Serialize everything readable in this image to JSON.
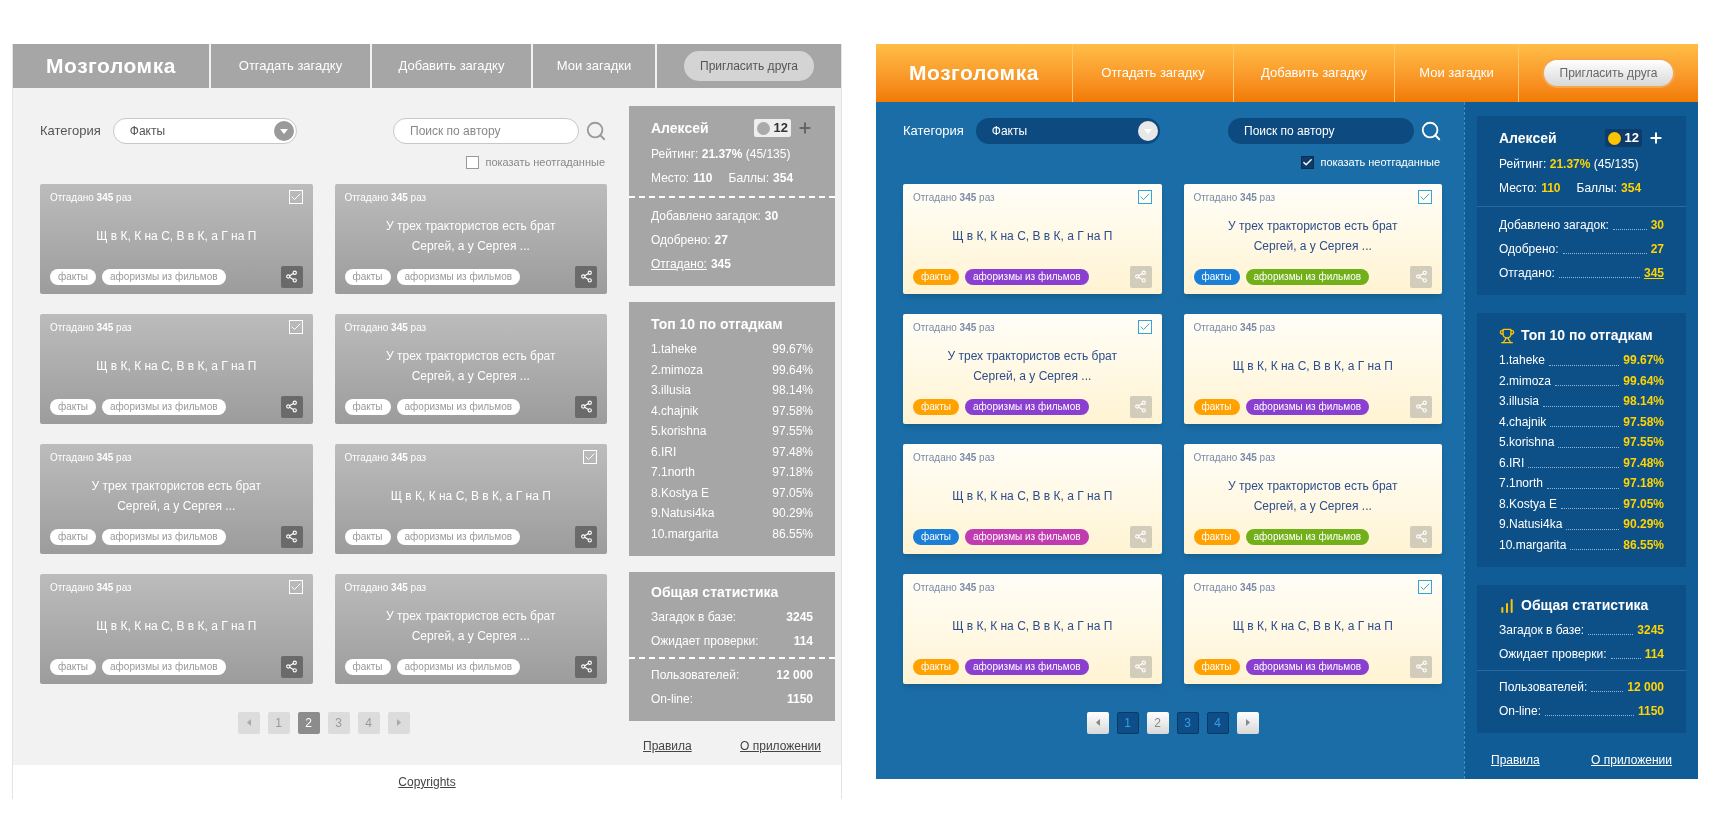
{
  "mockups": [
    {
      "kind": "wireframe",
      "header": {
        "logo": "Мозголомка",
        "nav": [
          "Отгадать загадку",
          "Добавить загадку",
          "Мои загадки"
        ],
        "invite": "Пригласить друга"
      },
      "filters": {
        "category_label": "Категория",
        "category": "Факты",
        "search_placeholder": "Поиск по автору",
        "show_unsolved": {
          "label": "показать неотгаданные",
          "checked": false
        }
      },
      "cards": [
        {
          "solved": "Отгадано **345** раз",
          "text": "Щ в К, К на С, В в К, а Г на П",
          "checked": true,
          "tags": [
            {
              "label": "факты"
            },
            {
              "label": "афоризмы из фильмов"
            }
          ]
        },
        {
          "solved": "Отгадано **345** раз",
          "text": "У трех трактористов есть брат Сергей, а у Сергея ...",
          "checked": false,
          "tags": [
            {
              "label": "факты"
            },
            {
              "label": "афоризмы из фильмов"
            }
          ]
        },
        {
          "solved": "Отгадано **345** раз",
          "text": "Щ в К, К на С, В в К, а Г на П",
          "checked": true,
          "tags": [
            {
              "label": "факты"
            },
            {
              "label": "афоризмы из фильмов"
            }
          ]
        },
        {
          "solved": "Отгадано **345** раз",
          "text": "У трех трактористов есть брат Сергей, а у Сергея ...",
          "checked": false,
          "tags": [
            {
              "label": "факты"
            },
            {
              "label": "афоризмы из фильмов"
            }
          ]
        },
        {
          "solved": "Отгадано **345** раз",
          "text": "У трех трактористов есть брат Сергей, а у Сергея ...",
          "checked": false,
          "tags": [
            {
              "label": "факты"
            },
            {
              "label": "афоризмы из фильмов"
            }
          ]
        },
        {
          "solved": "Отгадано **345** раз",
          "text": "Щ в К, К на С, В в К, а Г на П",
          "checked": true,
          "tags": [
            {
              "label": "факты"
            },
            {
              "label": "афоризмы из фильмов"
            }
          ]
        },
        {
          "solved": "Отгадано **345** раз",
          "text": "Щ в К, К на С, В в К, а Г на П",
          "checked": true,
          "tags": [
            {
              "label": "факты"
            },
            {
              "label": "афоризмы из фильмов"
            }
          ]
        },
        {
          "solved": "Отгадано **345** раз",
          "text": "У трех трактористов есть брат Сергей, а у Сергея ...",
          "checked": false,
          "tags": [
            {
              "label": "факты"
            },
            {
              "label": "афоризмы из фильмов"
            }
          ]
        }
      ],
      "pagination": [
        {
          "label": "1",
          "selected": false
        },
        {
          "label": "2",
          "selected": true
        },
        {
          "label": "3",
          "selected": false
        },
        {
          "label": "4",
          "selected": false
        }
      ],
      "profile": {
        "name": "Алексей",
        "coins": "12",
        "rating": "Рейтинг: **21.37%** (45/135)",
        "place": {
          "label": "Место:",
          "value": "110"
        },
        "points": {
          "label": "Баллы:",
          "value": "354"
        },
        "rows": [
          {
            "label": "Добавлено загадок:",
            "value": "30",
            "link": false
          },
          {
            "label": "Одобрено:",
            "value": "27",
            "link": false
          },
          {
            "label": "Отгадано:",
            "value": "345",
            "link": true
          }
        ]
      },
      "top10": {
        "title": "Топ 10 по отгадкам",
        "entries": [
          {
            "name": "1.taheke",
            "value": "99.67%"
          },
          {
            "name": "2.mimoza",
            "value": "99.64%"
          },
          {
            "name": "3.illusia",
            "value": "98.14%"
          },
          {
            "name": "4.chajnik",
            "value": "97.58%"
          },
          {
            "name": "5.korishna",
            "value": "97.55%"
          },
          {
            "name": "6.IRI",
            "value": "97.48%"
          },
          {
            "name": "7.1north",
            "value": "97.18%"
          },
          {
            "name": "8.Kostya E",
            "value": "97.05%"
          },
          {
            "name": "9.Natusi4ka",
            "value": "90.29%"
          },
          {
            "name": "10.margarita",
            "value": "86.55%"
          }
        ]
      },
      "stats": {
        "title": "Общая статистика",
        "groups": [
          [
            {
              "label": "Загадок в базе:",
              "value": "3245"
            },
            {
              "label": "Ожидает проверки:",
              "value": "114"
            }
          ],
          [
            {
              "label": "Пользователей:",
              "value": "12 000"
            },
            {
              "label": "On-line:",
              "value": "1150"
            }
          ]
        ]
      },
      "links": [
        "Правила",
        "О приложении"
      ],
      "footer": "Copyrights"
    },
    {
      "kind": "design",
      "header": {
        "logo": "Мозголомка",
        "nav": [
          "Отгадать загадку",
          "Добавить загадку",
          "Мои загадки"
        ],
        "invite": "Пригласить друга"
      },
      "filters": {
        "category_label": "Категория",
        "category": "Факты",
        "search_placeholder": "Поиск по автору",
        "show_unsolved": {
          "label": "показать неотгаданные",
          "checked": true
        }
      },
      "cards": [
        {
          "solved": "Отгадано **345** раз",
          "text": "Щ в К, К на С, В в К, а Г на П",
          "checked": true,
          "tags": [
            {
              "label": "факты",
              "color": "#ffa200"
            },
            {
              "label": "афоризмы из фильмов",
              "color": "#8a3fd0"
            }
          ]
        },
        {
          "solved": "Отгадано **345** раз",
          "text": "У трех трактористов есть брат Сергей, а у Сергея ...",
          "checked": true,
          "tags": [
            {
              "label": "факты",
              "color": "#1b7fd8"
            },
            {
              "label": "афоризмы из фильмов",
              "color": "#72b01a"
            }
          ]
        },
        {
          "solved": "Отгадано **345** раз",
          "text": "У трех трактористов есть брат Сергей, а у Сергея ...",
          "checked": true,
          "tags": [
            {
              "label": "факты",
              "color": "#ffa200"
            },
            {
              "label": "афоризмы из фильмов",
              "color": "#8a3fd0"
            }
          ]
        },
        {
          "solved": "Отгадано **345** раз",
          "text": "Щ в К, К на С, В в К, а Г на П",
          "checked": false,
          "tags": [
            {
              "label": "факты",
              "color": "#ffa200"
            },
            {
              "label": "афоризмы из фильмов",
              "color": "#8a3fd0"
            }
          ]
        },
        {
          "solved": "Отгадано **345** раз",
          "text": "Щ в К, К на С, В в К, а Г на П",
          "checked": false,
          "tags": [
            {
              "label": "факты",
              "color": "#1b7fd8"
            },
            {
              "label": "афоризмы из фильмов",
              "color": "#c03ab0"
            }
          ]
        },
        {
          "solved": "Отгадано **345** раз",
          "text": "У трех трактористов есть брат Сергей, а у Сергея ...",
          "checked": false,
          "tags": [
            {
              "label": "факты",
              "color": "#ffa200"
            },
            {
              "label": "афоризмы из фильмов",
              "color": "#72b01a"
            }
          ]
        },
        {
          "solved": "Отгадано **345** раз",
          "text": "Щ в К, К на С, В в К, а Г на П",
          "checked": false,
          "tags": [
            {
              "label": "факты",
              "color": "#ffa200"
            },
            {
              "label": "афоризмы из фильмов",
              "color": "#8a3fd0"
            }
          ]
        },
        {
          "solved": "Отгадано **345** раз",
          "text": "Щ в К, К на С, В в К, а Г на П",
          "checked": true,
          "tags": [
            {
              "label": "факты",
              "color": "#ffa200"
            },
            {
              "label": "афоризмы из фильмов",
              "color": "#8a3fd0"
            }
          ]
        }
      ],
      "pagination": [
        {
          "label": "1",
          "selected": false
        },
        {
          "label": "2",
          "selected": true
        },
        {
          "label": "3",
          "selected": false
        },
        {
          "label": "4",
          "selected": false
        }
      ],
      "profile": {
        "name": "Алексей",
        "coins": "12",
        "rating": "Рейтинг: **21.37%** (45/135)",
        "place": {
          "label": "Место:",
          "value": "110"
        },
        "points": {
          "label": "Баллы:",
          "value": "354"
        },
        "rows": [
          {
            "label": "Добавлено загадок:",
            "value": "30",
            "link": false
          },
          {
            "label": "Одобрено:",
            "value": "27",
            "link": false
          },
          {
            "label": "Отгадано:",
            "value": "345",
            "link": true
          }
        ]
      },
      "top10": {
        "title": "Топ 10 по отгадкам",
        "entries": [
          {
            "name": "1.taheke",
            "value": "99.67%"
          },
          {
            "name": "2.mimoza",
            "value": "99.64%"
          },
          {
            "name": "3.illusia",
            "value": "98.14%"
          },
          {
            "name": "4.chajnik",
            "value": "97.58%"
          },
          {
            "name": "5.korishna",
            "value": "97.55%"
          },
          {
            "name": "6.IRI",
            "value": "97.48%"
          },
          {
            "name": "7.1north",
            "value": "97.18%"
          },
          {
            "name": "8.Kostya E",
            "value": "97.05%"
          },
          {
            "name": "9.Natusi4ka",
            "value": "90.29%"
          },
          {
            "name": "10.margarita",
            "value": "86.55%"
          }
        ]
      },
      "stats": {
        "title": "Общая статистика",
        "groups": [
          [
            {
              "label": "Загадок в базе:",
              "value": "3245"
            },
            {
              "label": "Ожидает проверки:",
              "value": "114"
            }
          ],
          [
            {
              "label": "Пользователей:",
              "value": "12 000"
            },
            {
              "label": "On-line:",
              "value": "1150"
            }
          ]
        ]
      },
      "links": [
        "Правила",
        "О приложении"
      ]
    }
  ]
}
